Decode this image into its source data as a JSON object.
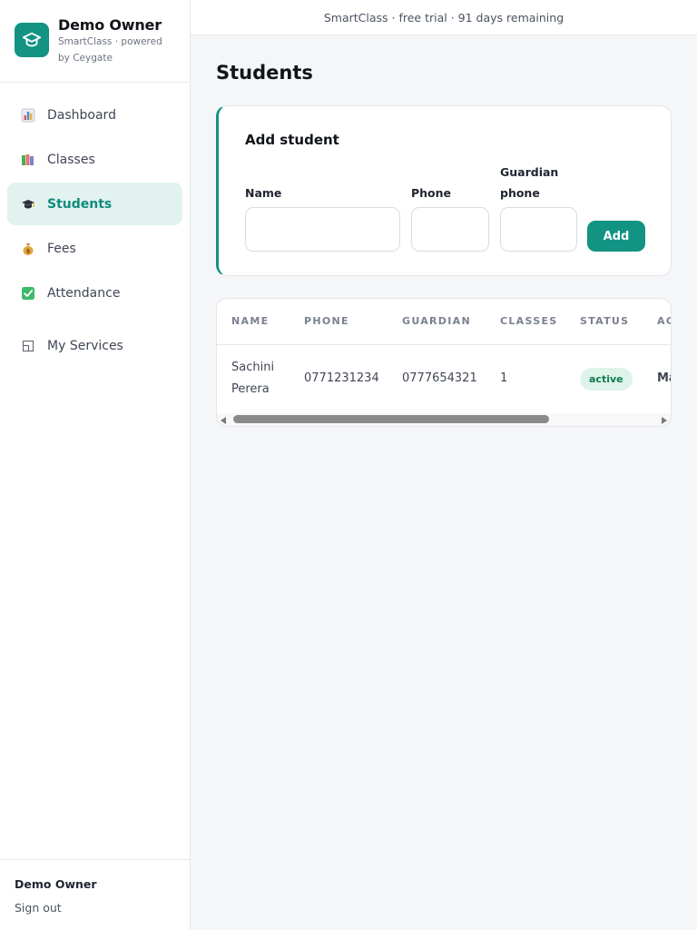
{
  "brand": {
    "title": "Demo Owner",
    "subtitle": "SmartClass · powered by Ceygate",
    "logo_icon": "graduation-cap-icon",
    "accent_color": "#129384"
  },
  "nav": {
    "items": [
      {
        "label": "Dashboard",
        "icon": "bar-chart-icon",
        "active": false
      },
      {
        "label": "Classes",
        "icon": "books-icon",
        "active": false
      },
      {
        "label": "Students",
        "icon": "graduation-cap-icon",
        "active": true
      },
      {
        "label": "Fees",
        "icon": "money-bag-icon",
        "active": false
      },
      {
        "label": "Attendance",
        "icon": "check-box-icon",
        "active": false
      },
      {
        "label": "My Services",
        "icon": "window-icon",
        "active": false
      }
    ]
  },
  "user": {
    "name": "Demo Owner",
    "sign_out_label": "Sign out"
  },
  "banner": {
    "text": "SmartClass · free trial · 91 days remaining"
  },
  "page": {
    "title": "Students"
  },
  "add_form": {
    "title": "Add student",
    "fields": [
      {
        "label": "Name",
        "value": "",
        "placeholder": ""
      },
      {
        "label": "Phone",
        "value": "",
        "placeholder": ""
      },
      {
        "label": "Guardian phone",
        "value": "",
        "placeholder": ""
      }
    ],
    "submit_label": "Add"
  },
  "table": {
    "columns": [
      "NAME",
      "PHONE",
      "GUARDIAN",
      "CLASSES",
      "STATUS",
      "AC"
    ],
    "rows": [
      {
        "name": "Sachini Perera",
        "phone": "0771231234",
        "guardian": "0777654321",
        "classes": "1",
        "status": "active",
        "action": "Ma"
      }
    ]
  }
}
